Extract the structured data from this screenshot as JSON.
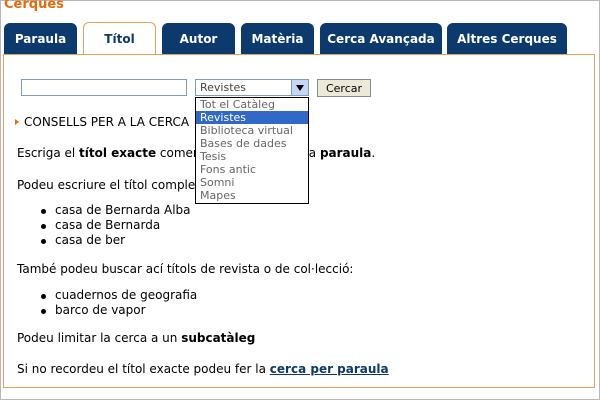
{
  "header": {
    "title": "Cerques"
  },
  "tabs": [
    {
      "label": "Paraula"
    },
    {
      "label": "Títol",
      "active": true
    },
    {
      "label": "Autor"
    },
    {
      "label": "Matèria"
    },
    {
      "label": "Cerca Avançada"
    },
    {
      "label": "Altres Cerques"
    }
  ],
  "search": {
    "query": "",
    "select_value": "Revistes",
    "submit_label": "Cercar",
    "options": [
      {
        "label": "Tot el Catàleg"
      },
      {
        "label": "Revistes",
        "selected": true
      },
      {
        "label": "Biblioteca virtual"
      },
      {
        "label": "Bases de dades"
      },
      {
        "label": "Tesis"
      },
      {
        "label": "Fons antic"
      },
      {
        "label": "Somni"
      },
      {
        "label": "Mapes"
      }
    ]
  },
  "content": {
    "advice_heading": "CONSELLS PER A LA CERCA",
    "p1_pre": "Escriga el ",
    "p1_bold1": "títol exacte",
    "p1_mid": " començant per la primera ",
    "p1_bold2": "paraula",
    "p1_post": ".",
    "p2": "Podeu escriure el títol complet o part:",
    "examples1": [
      "casa de Bernarda Alba",
      "casa de Bernarda",
      "casa de ber"
    ],
    "p3": "També podeu buscar ací títols de revista o de col·lecció:",
    "examples2": [
      "cuadernos de geografia",
      "barco de vapor"
    ],
    "p4_pre": "Podeu limitar la cerca a un ",
    "p4_bold": "subcatàleg",
    "p5_pre": "Si no recordeu el títol exacte podeu fer la ",
    "p5_link": "cerca per paraula"
  },
  "colors": {
    "tab_bg": "#0c3a6c",
    "accent": "#e36c0a",
    "border": "#e8a05a",
    "selection": "#3169c6"
  }
}
